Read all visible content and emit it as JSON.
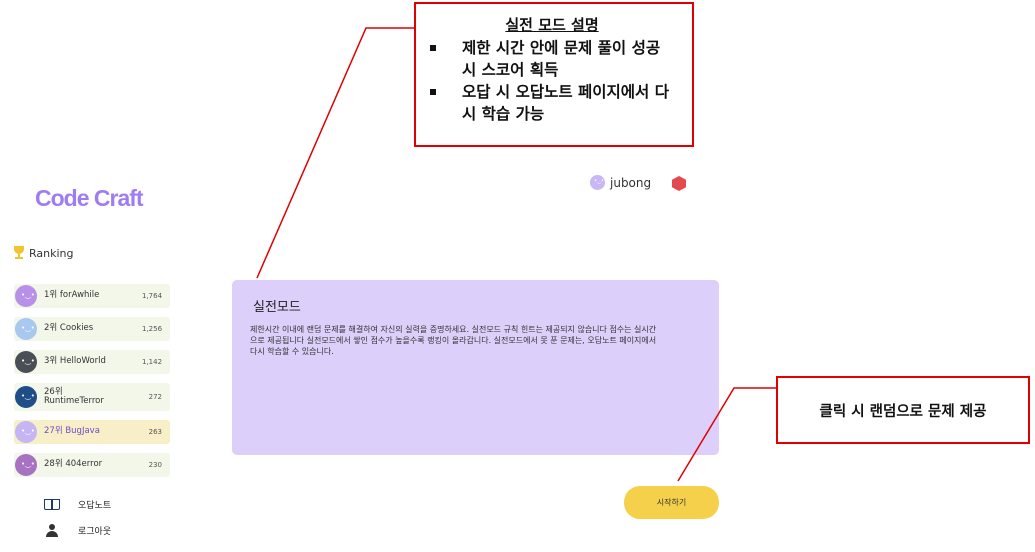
{
  "app": {
    "logo_text": "Code Craft"
  },
  "ranking": {
    "title": "Ranking",
    "items": [
      {
        "label": "1위 forAwhile",
        "score": "1,764",
        "avatar_color": "#b990e8",
        "highlight": false
      },
      {
        "label": "2위 Cookies",
        "score": "1,256",
        "avatar_color": "#a9c8f0",
        "highlight": false
      },
      {
        "label": "3위 HelloWorld",
        "score": "1,142",
        "avatar_color": "#4a4f55",
        "highlight": false
      },
      {
        "label": "26위 RuntimeTerror",
        "score": "272",
        "avatar_color": "#1f4d88",
        "highlight": false
      },
      {
        "label": "27위 BugJava",
        "score": "263",
        "avatar_color": "#c6b4f4",
        "highlight": true
      },
      {
        "label": "28위 404error",
        "score": "230",
        "avatar_color": "#a872c2",
        "highlight": false
      }
    ]
  },
  "menu": {
    "wrong_note": "오답노트",
    "logout": "로그아웃"
  },
  "user": {
    "name": "jubong",
    "badge_color": "#e5484d"
  },
  "main": {
    "title": "실전모드",
    "description": "제한시간 이내에 랜덤 문제를 해결하여 자신의 실력을 증명하세요. 실전모드 규칙 힌트는 제공되지 않습니다 점수는 실시간으로 제공됩니다 실전모드에서 쌓인 점수가 높을수록 랭킹이 올라갑니다. 실전모드에서 못 푼 문제는, 오답노트 페이지에서 다시 학습할 수 있습니다.",
    "start_button": "시작하기"
  },
  "annotations": {
    "mode_title": "실전 모드 설명",
    "mode_points": [
      "제한 시간 안에 문제 풀이 성공 시 스코어 획득",
      "오답 시 오답노트 페이지에서 다시 학습 가능"
    ],
    "start_note": "클릭 시 랜덤으로 문제 제공"
  },
  "colors": {
    "accent": "#9f7cf2",
    "panel": "#dccff9",
    "start_button": "#f5d04a",
    "annotation_border": "#e00000"
  }
}
